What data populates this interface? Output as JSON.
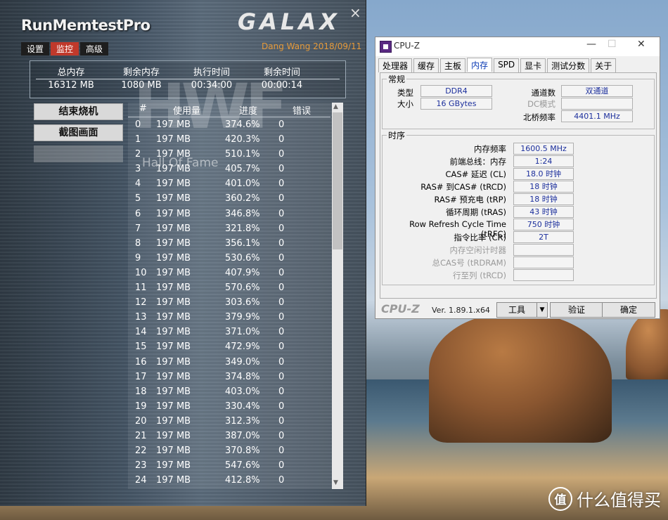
{
  "runmemtest": {
    "title": "RunMemtestPro",
    "brand": "GALAX",
    "close_icon": "×",
    "author": "Dang Wang 2018/09/11",
    "tabs": [
      {
        "label": "设置",
        "active": false
      },
      {
        "label": "监控",
        "active": true
      },
      {
        "label": "高级",
        "active": false
      }
    ],
    "summary": [
      {
        "label": "总内存",
        "value": "16312 MB"
      },
      {
        "label": "剩余内存",
        "value": "1080 MB"
      },
      {
        "label": "执行时间",
        "value": "00:34:00"
      },
      {
        "label": "剩余时间",
        "value": "00:00:14"
      }
    ],
    "buttons": {
      "stop": "结束烧机",
      "screenshot": "截图画面"
    },
    "watermark": {
      "big": "HWF",
      "text": "Hall Of Fame"
    },
    "table": {
      "headers": [
        "#",
        "使用量",
        "进度",
        "错误"
      ],
      "rows": [
        [
          "0",
          "197 MB",
          "374.6%",
          "0"
        ],
        [
          "1",
          "197 MB",
          "420.3%",
          "0"
        ],
        [
          "2",
          "197 MB",
          "510.1%",
          "0"
        ],
        [
          "3",
          "197 MB",
          "405.7%",
          "0"
        ],
        [
          "4",
          "197 MB",
          "401.0%",
          "0"
        ],
        [
          "5",
          "197 MB",
          "360.2%",
          "0"
        ],
        [
          "6",
          "197 MB",
          "346.8%",
          "0"
        ],
        [
          "7",
          "197 MB",
          "321.8%",
          "0"
        ],
        [
          "8",
          "197 MB",
          "356.1%",
          "0"
        ],
        [
          "9",
          "197 MB",
          "530.6%",
          "0"
        ],
        [
          "10",
          "197 MB",
          "407.9%",
          "0"
        ],
        [
          "11",
          "197 MB",
          "570.6%",
          "0"
        ],
        [
          "12",
          "197 MB",
          "303.6%",
          "0"
        ],
        [
          "13",
          "197 MB",
          "379.9%",
          "0"
        ],
        [
          "14",
          "197 MB",
          "371.0%",
          "0"
        ],
        [
          "15",
          "197 MB",
          "472.9%",
          "0"
        ],
        [
          "16",
          "197 MB",
          "349.0%",
          "0"
        ],
        [
          "17",
          "197 MB",
          "374.8%",
          "0"
        ],
        [
          "18",
          "197 MB",
          "403.0%",
          "0"
        ],
        [
          "19",
          "197 MB",
          "330.4%",
          "0"
        ],
        [
          "20",
          "197 MB",
          "312.3%",
          "0"
        ],
        [
          "21",
          "197 MB",
          "387.0%",
          "0"
        ],
        [
          "22",
          "197 MB",
          "370.8%",
          "0"
        ],
        [
          "23",
          "197 MB",
          "547.6%",
          "0"
        ],
        [
          "24",
          "197 MB",
          "412.8%",
          "0"
        ]
      ]
    }
  },
  "cpuz": {
    "title": "CPU-Z",
    "tabs": [
      {
        "label": "处理器",
        "active": false
      },
      {
        "label": "缓存",
        "active": false
      },
      {
        "label": "主板",
        "active": false
      },
      {
        "label": "内存",
        "active": true
      },
      {
        "label": "SPD",
        "active": false
      },
      {
        "label": "显卡",
        "active": false
      },
      {
        "label": "测试分数",
        "active": false
      },
      {
        "label": "关于",
        "active": false
      }
    ],
    "general": {
      "title": "常规",
      "type_label": "类型",
      "type_value": "DDR4",
      "size_label": "大小",
      "size_value": "16 GBytes",
      "channels_label": "通道数",
      "channels_value": "双通道",
      "dc_label": "DC模式",
      "dc_value": "",
      "nb_label": "北桥频率",
      "nb_value": "4401.1 MHz"
    },
    "timings": {
      "title": "时序",
      "items": [
        {
          "label": "内存频率",
          "value": "1600.5 MHz",
          "dim": false
        },
        {
          "label": "前端总线：内存",
          "value": "1:24",
          "dim": false
        },
        {
          "label": "CAS# 延迟 (CL)",
          "value": "18.0 时钟",
          "dim": false
        },
        {
          "label": "RAS# 到CAS# (tRCD)",
          "value": "18 时钟",
          "dim": false
        },
        {
          "label": "RAS# 预充电 (tRP)",
          "value": "18 时钟",
          "dim": false
        },
        {
          "label": "循环周期 (tRAS)",
          "value": "43 时钟",
          "dim": false
        },
        {
          "label": "Row Refresh Cycle Time (tRFC)",
          "value": "750 时钟",
          "dim": false
        },
        {
          "label": "指令比率 (CR)",
          "value": "2T",
          "dim": false
        },
        {
          "label": "内存空闲计时器",
          "value": "",
          "dim": true
        },
        {
          "label": "总CAS号 (tRDRAM)",
          "value": "",
          "dim": true
        },
        {
          "label": "行至列 (tRCD)",
          "value": "",
          "dim": true
        }
      ]
    },
    "footer": {
      "logo": "CPU-Z",
      "version": "Ver. 1.89.1.x64",
      "tools": "工具",
      "validate": "验证",
      "ok": "确定"
    }
  },
  "desktop": {
    "watermark_icon": "值",
    "watermark_text": "什么值得买"
  },
  "colors": {
    "accent_tab": "#c0392b",
    "author": "#e59a3a",
    "cpuz_value": "#1c2f9c",
    "cpuz_tab_active": "#0b3bb5"
  }
}
